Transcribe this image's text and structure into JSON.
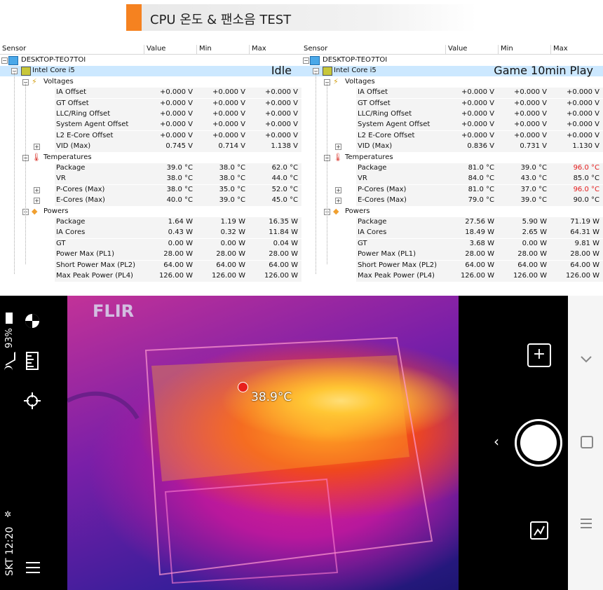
{
  "title": "CPU 온도 & 팬소음 TEST",
  "columns": {
    "sensor": "Sensor",
    "value": "Value",
    "min": "Min",
    "max": "Max"
  },
  "panels": [
    {
      "label": "Idle",
      "host": "DESKTOP-TEO7TOI",
      "cpu": "Intel Core i5",
      "groups": {
        "voltages": "Voltages",
        "temperatures": "Temperatures",
        "powers": "Powers"
      },
      "rows": [
        {
          "name": "IA Offset",
          "value": "+0.000 V",
          "min": "+0.000 V",
          "max": "+0.000 V"
        },
        {
          "name": "GT Offset",
          "value": "+0.000 V",
          "min": "+0.000 V",
          "max": "+0.000 V"
        },
        {
          "name": "LLC/Ring Offset",
          "value": "+0.000 V",
          "min": "+0.000 V",
          "max": "+0.000 V"
        },
        {
          "name": "System Agent Offset",
          "value": "+0.000 V",
          "min": "+0.000 V",
          "max": "+0.000 V"
        },
        {
          "name": "L2 E-Core Offset",
          "value": "+0.000 V",
          "min": "+0.000 V",
          "max": "+0.000 V"
        },
        {
          "name": "VID (Max)",
          "value": "0.745 V",
          "min": "0.714 V",
          "max": "1.138 V"
        },
        {
          "name": "Package",
          "value": "39.0 °C",
          "min": "38.0 °C",
          "max": "62.0 °C"
        },
        {
          "name": "VR",
          "value": "38.0 °C",
          "min": "38.0 °C",
          "max": "44.0 °C"
        },
        {
          "name": "P-Cores (Max)",
          "value": "38.0 °C",
          "min": "35.0 °C",
          "max": "52.0 °C"
        },
        {
          "name": "E-Cores (Max)",
          "value": "40.0 °C",
          "min": "39.0 °C",
          "max": "45.0 °C"
        },
        {
          "name": "Package",
          "value": "1.64 W",
          "min": "1.19 W",
          "max": "16.35 W"
        },
        {
          "name": "IA Cores",
          "value": "0.43 W",
          "min": "0.32 W",
          "max": "11.84 W"
        },
        {
          "name": "GT",
          "value": "0.00 W",
          "min": "0.00 W",
          "max": "0.04 W"
        },
        {
          "name": "Power Max (PL1)",
          "value": "28.00 W",
          "min": "28.00 W",
          "max": "28.00 W"
        },
        {
          "name": "Short Power Max (PL2)",
          "value": "64.00 W",
          "min": "64.00 W",
          "max": "64.00 W"
        },
        {
          "name": "Max Peak Power (PL4)",
          "value": "126.00 W",
          "min": "126.00 W",
          "max": "126.00 W"
        }
      ]
    },
    {
      "label": "Game 10min Play",
      "host": "DESKTOP-TEO7TOI",
      "cpu": "Intel Core i5",
      "groups": {
        "voltages": "Voltages",
        "temperatures": "Temperatures",
        "powers": "Powers"
      },
      "rows": [
        {
          "name": "IA Offset",
          "value": "+0.000 V",
          "min": "+0.000 V",
          "max": "+0.000 V"
        },
        {
          "name": "GT Offset",
          "value": "+0.000 V",
          "min": "+0.000 V",
          "max": "+0.000 V"
        },
        {
          "name": "LLC/Ring Offset",
          "value": "+0.000 V",
          "min": "+0.000 V",
          "max": "+0.000 V"
        },
        {
          "name": "System Agent Offset",
          "value": "+0.000 V",
          "min": "+0.000 V",
          "max": "+0.000 V"
        },
        {
          "name": "L2 E-Core Offset",
          "value": "+0.000 V",
          "min": "+0.000 V",
          "max": "+0.000 V"
        },
        {
          "name": "VID (Max)",
          "value": "0.836 V",
          "min": "0.731 V",
          "max": "1.130 V"
        },
        {
          "name": "Package",
          "value": "81.0 °C",
          "min": "39.0 °C",
          "max": "96.0 °C"
        },
        {
          "name": "VR",
          "value": "84.0 °C",
          "min": "43.0 °C",
          "max": "85.0 °C"
        },
        {
          "name": "P-Cores (Max)",
          "value": "81.0 °C",
          "min": "37.0 °C",
          "max": "96.0 °C"
        },
        {
          "name": "E-Cores (Max)",
          "value": "79.0 °C",
          "min": "39.0 °C",
          "max": "90.0 °C"
        },
        {
          "name": "Package",
          "value": "27.56 W",
          "min": "5.90 W",
          "max": "71.19 W"
        },
        {
          "name": "IA Cores",
          "value": "18.49 W",
          "min": "2.65 W",
          "max": "64.31 W"
        },
        {
          "name": "GT",
          "value": "3.68 W",
          "min": "0.00 W",
          "max": "9.81 W"
        },
        {
          "name": "Power Max (PL1)",
          "value": "28.00 W",
          "min": "28.00 W",
          "max": "28.00 W"
        },
        {
          "name": "Short Power Max (PL2)",
          "value": "64.00 W",
          "min": "64.00 W",
          "max": "64.00 W"
        },
        {
          "name": "Max Peak Power (PL4)",
          "value": "126.00 W",
          "min": "126.00 W",
          "max": "126.00 W"
        }
      ]
    }
  ],
  "highlight_color": "#e41b1b",
  "accent_color": "#f58220",
  "phone": {
    "status_text": "SKT 12:20",
    "battery": "93%",
    "flir_logo": "FLIR",
    "spot_temp": "38.9°C",
    "icons": [
      "color-palette-icon",
      "ruler-icon",
      "crosshair-icon",
      "menu-icon",
      "plus-icon",
      "chevron-left-icon",
      "shutter-button",
      "gallery-icon",
      "chevron-down-icon",
      "recent-apps-icon",
      "home-icon"
    ]
  }
}
